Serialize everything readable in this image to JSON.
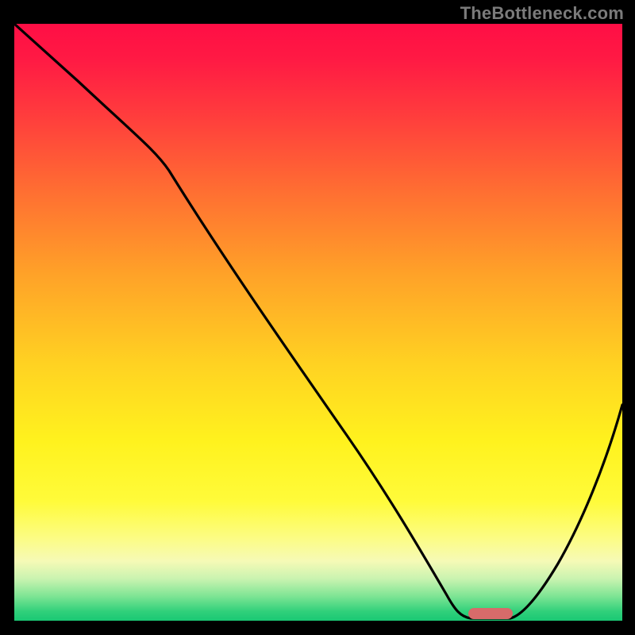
{
  "watermark": "TheBottleneck.com",
  "colors": {
    "curve": "#000000",
    "marker": "#d76b6a",
    "background": "#000000"
  },
  "chart_data": {
    "type": "line",
    "title": "",
    "xlabel": "",
    "ylabel": "",
    "xlim": [
      0,
      100
    ],
    "ylim": [
      0,
      100
    ],
    "grid": false,
    "legend": false,
    "series": [
      {
        "name": "bottleneck-curve",
        "x": [
          0,
          10,
          23,
          35,
          45,
          55,
          63,
          69,
          72,
          75,
          79,
          82,
          86,
          90,
          95,
          100
        ],
        "y": [
          100,
          90,
          79,
          62,
          47,
          33,
          21,
          12,
          6,
          2,
          0,
          0,
          3,
          10,
          22,
          38
        ]
      }
    ],
    "marker": {
      "x_center": 79,
      "y": 0,
      "width_pct": 7
    },
    "background_gradient": {
      "stops": [
        {
          "pct": 0,
          "color": "#ff0e45"
        },
        {
          "pct": 15,
          "color": "#ff3b3d"
        },
        {
          "pct": 42,
          "color": "#ffa228"
        },
        {
          "pct": 70,
          "color": "#fff21e"
        },
        {
          "pct": 90,
          "color": "#f6fab6"
        },
        {
          "pct": 100,
          "color": "#1ac874"
        }
      ]
    }
  }
}
